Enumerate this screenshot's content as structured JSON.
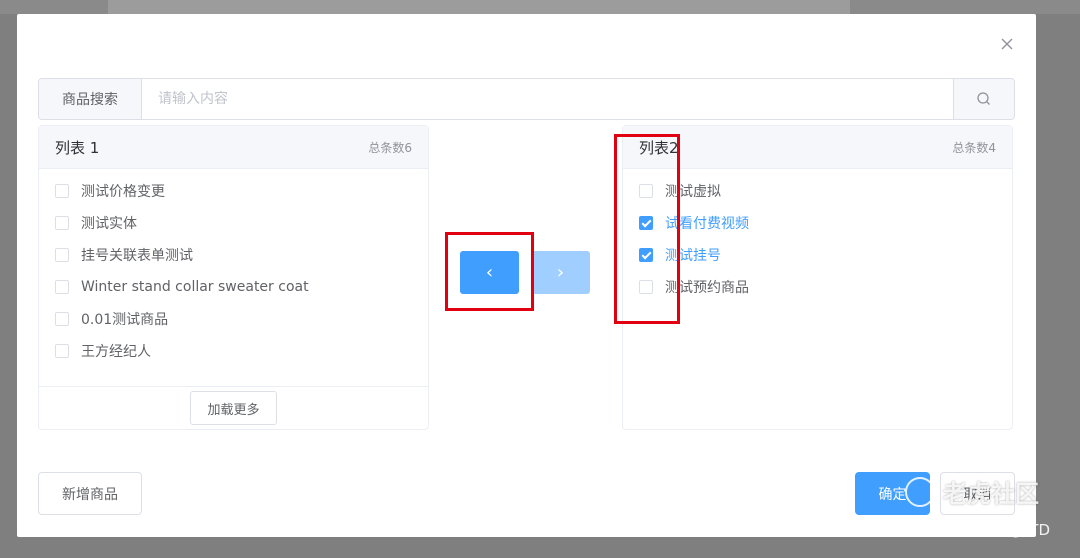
{
  "search": {
    "label": "商品搜索",
    "placeholder": "请输入内容",
    "value": ""
  },
  "left_panel": {
    "title": "列表 1",
    "count": "总条数6",
    "items": [
      {
        "label": "测试价格变更",
        "checked": false
      },
      {
        "label": "测试实体",
        "checked": false
      },
      {
        "label": "挂号关联表单测试",
        "checked": false
      },
      {
        "label": "Winter stand collar sweater coat",
        "checked": false
      },
      {
        "label": "0.01测试商品",
        "checked": false
      },
      {
        "label": "王方经纪人",
        "checked": false
      }
    ],
    "load_more": "加载更多"
  },
  "right_panel": {
    "title": "列表2",
    "count": "总条数4",
    "items": [
      {
        "label": "测试虚拟",
        "checked": false
      },
      {
        "label": "试看付费视频",
        "checked": true
      },
      {
        "label": "测试挂号",
        "checked": true
      },
      {
        "label": "测试预约商品",
        "checked": false
      }
    ]
  },
  "transfer": {
    "left_arrow": "‹",
    "right_arrow": "›"
  },
  "footer": {
    "add_label": "新增商品",
    "confirm_label": "确定",
    "cancel_label": "取消"
  },
  "watermark": {
    "text": "老虎社区",
    "sub": "@LTD"
  },
  "colors": {
    "primary": "#409eff",
    "primary_disabled": "#a0cfff",
    "highlight": "#e0000f"
  }
}
